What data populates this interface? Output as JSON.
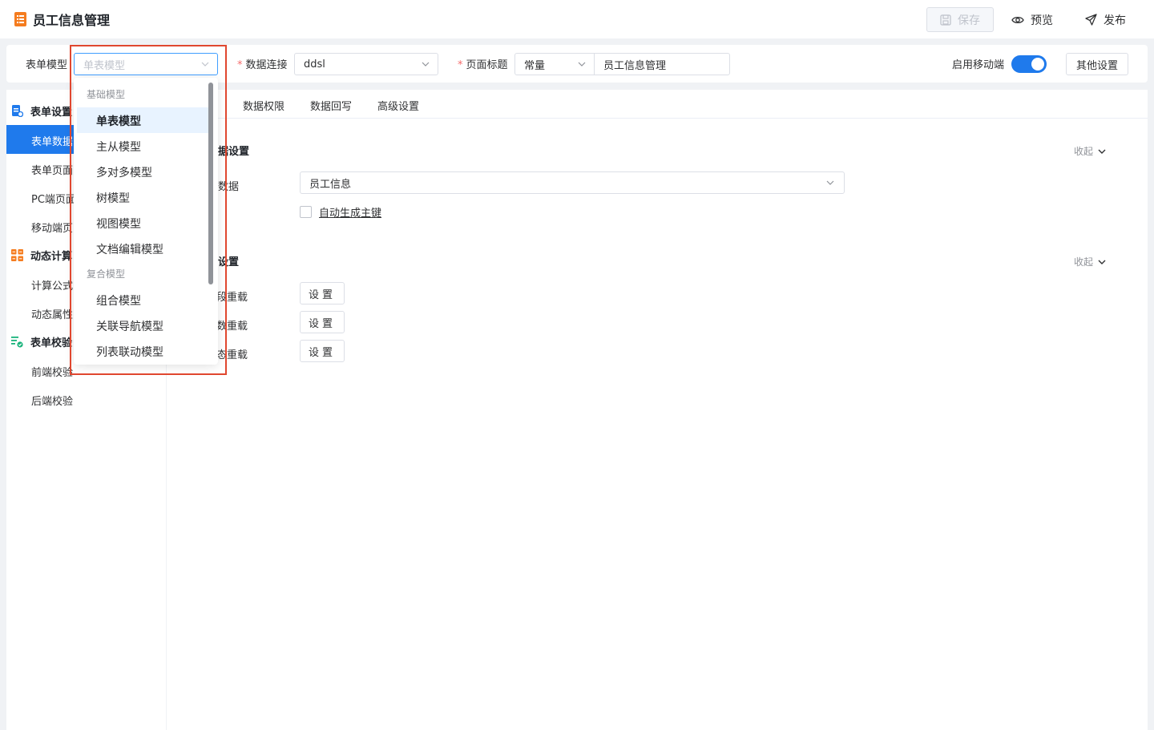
{
  "header": {
    "title": "员工信息管理",
    "save_label": "保存",
    "preview_label": "预览",
    "publish_label": "发布"
  },
  "config": {
    "form_model_label": "表单模型",
    "form_model_placeholder": "单表模型",
    "data_conn_label": "数据连接",
    "data_conn_value": "ddsl",
    "page_title_label": "页面标题",
    "page_title_type": "常量",
    "page_title_value": "员工信息管理",
    "mobile_label": "启用移动端",
    "mobile_enabled": true,
    "other_settings_label": "其他设置"
  },
  "sidebar": {
    "groups": [
      {
        "label": "表单设置",
        "items": [
          "表单数据",
          "表单页面",
          "PC端页面",
          "移动端页"
        ]
      },
      {
        "label": "动态计算",
        "items": [
          "计算公式",
          "动态属性"
        ]
      },
      {
        "label": "表单校验",
        "items": [
          "前端校验",
          "后端校验"
        ]
      }
    ],
    "group1_label": "表单设置",
    "group2_label": "动态计算",
    "group3_label": "表单校验",
    "item_form_data": "表单数据",
    "item_form_page": "表单页面",
    "item_pc_page": "PC端页面",
    "item_mobile_page": "移动端页",
    "item_formula": "计算公式",
    "item_dynamic_attr": "动态属性",
    "item_frontend_check": "前端校验",
    "item_backend_check": "后端校验"
  },
  "tabs": {
    "t1": "数据权限",
    "t2": "数据回写",
    "t3": "高级设置"
  },
  "main": {
    "section1_title": "据设置",
    "section1_collapse": "收起",
    "main_data_label": "数据",
    "main_data_value": "员工信息",
    "auto_pk_label": "自动生成主键",
    "section2_title": "设置",
    "section2_collapse": "收起",
    "reload1_label": "段重载",
    "reload2_label": "数重载",
    "reload3_label": "态重载",
    "set_label": "设置"
  },
  "dropdown": {
    "group_basic": "基础模型",
    "group_composite": "复合模型",
    "basic_items": [
      "单表模型",
      "主从模型",
      "多对多模型",
      "树模型",
      "视图模型",
      "文档编辑模型"
    ],
    "composite_items": [
      "组合模型",
      "关联导航模型",
      "列表联动模型"
    ],
    "selected": "单表模型"
  },
  "colors": {
    "accent": "#1f7aec",
    "highlight_border": "#e0472f",
    "selected_bg": "#e8f3ff"
  }
}
